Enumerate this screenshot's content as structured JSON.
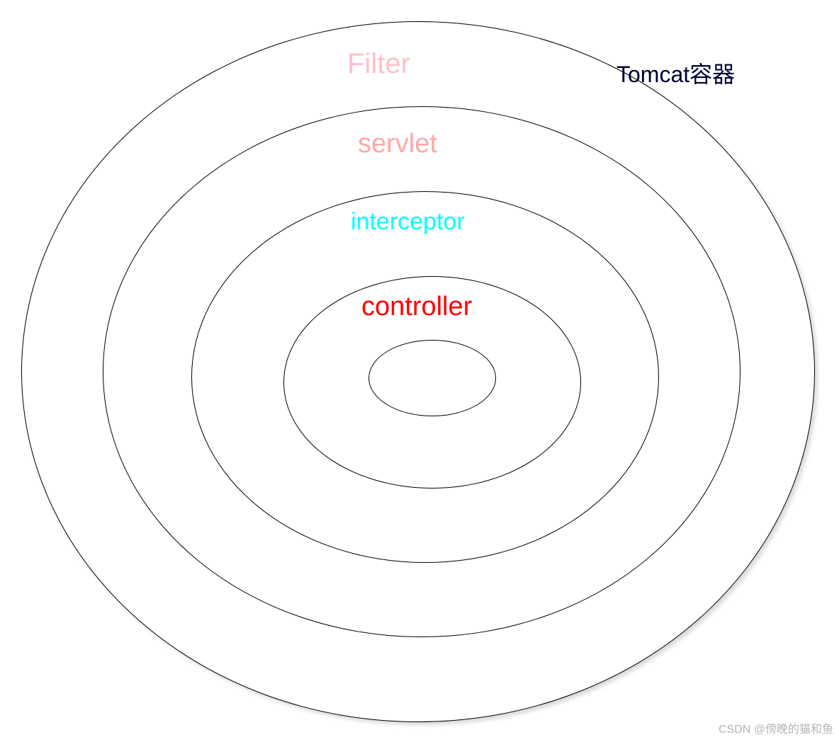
{
  "diagram": {
    "layers": {
      "outer": {
        "label": "Filter",
        "color": "#ffc0cb"
      },
      "second": {
        "label": "servlet",
        "color": "#ffa7a7"
      },
      "third": {
        "label": "interceptor",
        "color": "#00ffff"
      },
      "fourth": {
        "label": "controller",
        "color": "#ff0000"
      }
    },
    "container_label": "Tomcat容器"
  },
  "watermark": "CSDN @傍晚的猫和鱼"
}
